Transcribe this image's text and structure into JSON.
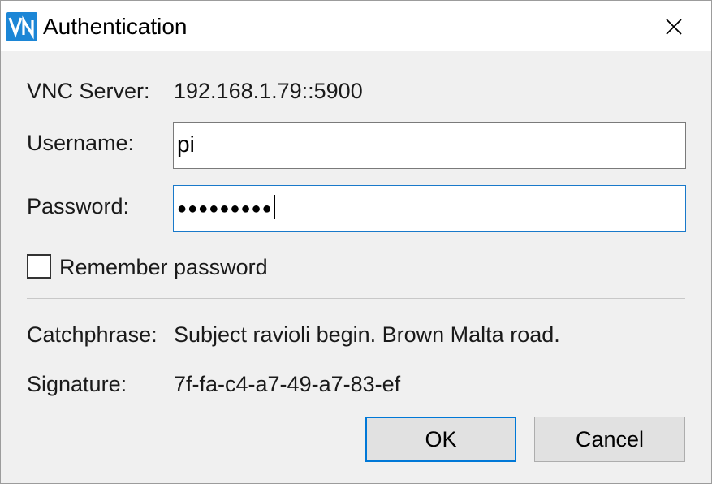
{
  "window": {
    "title": "Authentication",
    "app_icon": "vnc-logo-icon",
    "close_icon": "close-icon"
  },
  "server": {
    "label": "VNC Server:",
    "value": "192.168.1.79::5900"
  },
  "username": {
    "label": "Username:",
    "value": "pi"
  },
  "password": {
    "label": "Password:",
    "masked_value": "●●●●●●●●●"
  },
  "remember": {
    "label": "Remember password",
    "checked": false
  },
  "catchphrase": {
    "label": "Catchphrase:",
    "value": "Subject ravioli begin. Brown Malta road."
  },
  "signature": {
    "label": "Signature:",
    "value": "7f-fa-c4-a7-49-a7-83-ef"
  },
  "buttons": {
    "ok_label": "OK",
    "cancel_label": "Cancel"
  },
  "colors": {
    "accent": "#0078d7",
    "icon_bg": "#1c86d6",
    "window_bg": "#f0f0f0",
    "titlebar_bg": "#ffffff"
  }
}
